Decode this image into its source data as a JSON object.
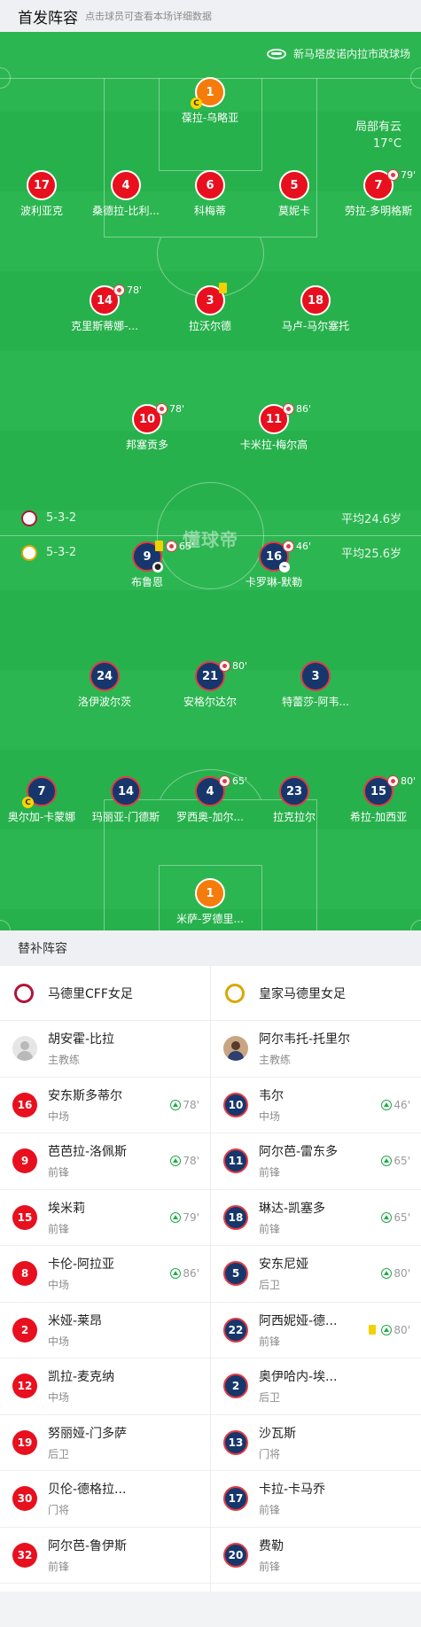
{
  "header": {
    "title": "首发阵容",
    "subtitle": "点击球员可查看本场详细数据"
  },
  "pitch": {
    "venue": "新马塔皮诺内拉市政球场",
    "weather": {
      "condition": "局部有云",
      "temp": "17°C"
    },
    "watermark": "懂球帝",
    "home": {
      "formation": "5-3-2",
      "avg_age": "平均24.6岁"
    },
    "away": {
      "formation": "5-3-2",
      "avg_age": "平均25.6岁"
    },
    "captain_mark": "C",
    "home_players": [
      {
        "num": "1",
        "name": "葆拉-乌略亚"
      },
      {
        "num": "17",
        "name": "波利亚克"
      },
      {
        "num": "4",
        "name": "桑德拉-比利..."
      },
      {
        "num": "6",
        "name": "科梅蒂"
      },
      {
        "num": "5",
        "name": "莫妮卡"
      },
      {
        "num": "7",
        "name": "劳拉-多明格斯",
        "sub": "79'"
      },
      {
        "num": "14",
        "name": "克里斯蒂娜-...",
        "sub": "78'"
      },
      {
        "num": "3",
        "name": "拉沃尔德"
      },
      {
        "num": "18",
        "name": "马卢-马尔塞托"
      },
      {
        "num": "10",
        "name": "邦塞贡多",
        "sub": "78'"
      },
      {
        "num": "11",
        "name": "卡米拉-梅尔高",
        "sub": "86'"
      }
    ],
    "away_players": [
      {
        "num": "9",
        "name": "布鲁恩",
        "sub": "65'"
      },
      {
        "num": "16",
        "name": "卡罗琳-默勒",
        "sub": "46'"
      },
      {
        "num": "24",
        "name": "洛伊波尔茨"
      },
      {
        "num": "21",
        "name": "安格尔达尔",
        "sub": "80'"
      },
      {
        "num": "3",
        "name": "特蕾莎-阿韦..."
      },
      {
        "num": "7",
        "name": "奥尔加-卡蒙娜"
      },
      {
        "num": "14",
        "name": "玛丽亚-门德斯"
      },
      {
        "num": "4",
        "name": "罗西奥-加尔...",
        "sub": "65'"
      },
      {
        "num": "23",
        "name": "拉克拉尔"
      },
      {
        "num": "15",
        "name": "希拉-加西亚",
        "sub": "80'"
      },
      {
        "num": "1",
        "name": "米萨-罗德里..."
      }
    ]
  },
  "subs_title": "替补阵容",
  "home_team": {
    "name": "马德里CFF女足",
    "coach": {
      "name": "胡安霍-比拉",
      "role": "主教练"
    },
    "subs": [
      {
        "num": "16",
        "name": "安东斯多蒂尔",
        "pos": "中场",
        "min": "78'"
      },
      {
        "num": "9",
        "name": "芭芭拉-洛佩斯",
        "pos": "前锋",
        "min": "78'"
      },
      {
        "num": "15",
        "name": "埃米莉",
        "pos": "前锋",
        "min": "79'"
      },
      {
        "num": "8",
        "name": "卡伦-阿拉亚",
        "pos": "中场",
        "min": "86'"
      },
      {
        "num": "2",
        "name": "米娅-莱昂",
        "pos": "中场"
      },
      {
        "num": "12",
        "name": "凯拉-麦克纳",
        "pos": "中场"
      },
      {
        "num": "19",
        "name": "努丽娅-门多萨",
        "pos": "后卫"
      },
      {
        "num": "30",
        "name": "贝伦-德格拉...",
        "pos": "门将"
      },
      {
        "num": "32",
        "name": "阿尔芭-鲁伊斯",
        "pos": "前锋"
      }
    ]
  },
  "away_team": {
    "name": "皇家马德里女足",
    "coach": {
      "name": "阿尔韦托-托里尔",
      "role": "主教练"
    },
    "subs": [
      {
        "num": "10",
        "name": "韦尔",
        "pos": "中场",
        "min": "46'"
      },
      {
        "num": "11",
        "name": "阿尔芭-雷东多",
        "pos": "前锋",
        "min": "65'"
      },
      {
        "num": "18",
        "name": "琳达-凯塞多",
        "pos": "前锋",
        "min": "65'"
      },
      {
        "num": "5",
        "name": "安东尼娅",
        "pos": "后卫",
        "min": "80'"
      },
      {
        "num": "22",
        "name": "阿西妮娅-德...",
        "pos": "前锋",
        "min": "80'"
      },
      {
        "num": "2",
        "name": "奥伊哈内-埃...",
        "pos": "后卫"
      },
      {
        "num": "13",
        "name": "沙瓦斯",
        "pos": "门将"
      },
      {
        "num": "17",
        "name": "卡拉-卡马乔",
        "pos": "前锋"
      },
      {
        "num": "20",
        "name": "费勒",
        "pos": "前锋"
      }
    ]
  },
  "colors": {
    "pitch": "#27b14c",
    "home": "#e8101e",
    "away": "#17376c",
    "gk": "#f57c0b",
    "sub_in": "#23a84b",
    "yellow": "#f5d000"
  }
}
